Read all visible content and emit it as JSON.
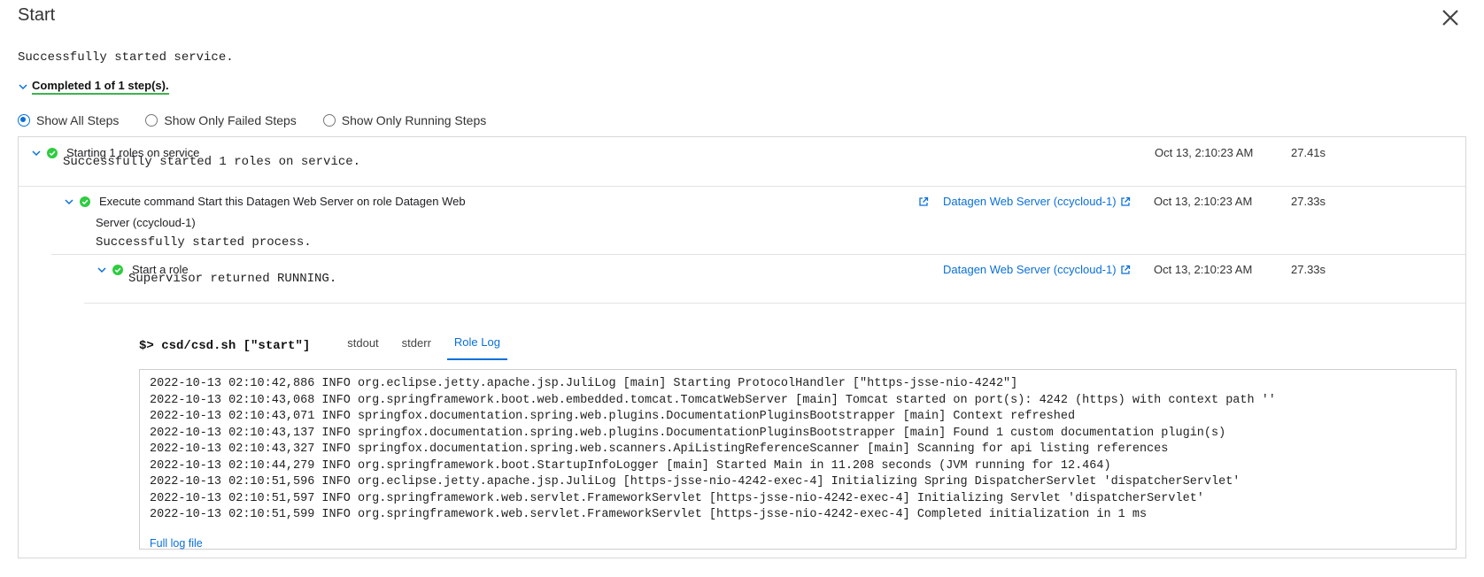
{
  "dialog": {
    "title": "Start",
    "close_icon": "close-icon"
  },
  "status_message": "Successfully started service.",
  "steps_summary": "Completed 1 of 1 step(s).",
  "filters": [
    {
      "label": "Show All Steps",
      "selected": true
    },
    {
      "label": "Show Only Failed Steps",
      "selected": false
    },
    {
      "label": "Show Only Running Steps",
      "selected": false
    }
  ],
  "steps": [
    {
      "label": "Starting 1 roles on service",
      "detail": "Successfully started 1 roles on service.",
      "time": "Oct 13, 2:10:23 AM",
      "duration": "27.41s",
      "status_icon": "check-circle-icon"
    },
    {
      "label": "Execute command Start this Datagen Web Server on role Datagen Web Server (ccycloud-1)",
      "label_line1": "Execute command Start this Datagen Web Server on role Datagen Web",
      "label_line2": "Server (ccycloud-1)",
      "detail": "Successfully started process.",
      "link": "Datagen Web Server (ccycloud-1)",
      "time": "Oct 13, 2:10:23 AM",
      "duration": "27.33s",
      "status_icon": "check-circle-icon"
    },
    {
      "label": "Start a role",
      "detail": "Supervisor returned RUNNING.",
      "link": "Datagen Web Server (ccycloud-1)",
      "time": "Oct 13, 2:10:23 AM",
      "duration": "27.33s",
      "status_icon": "check-circle-icon"
    }
  ],
  "command": {
    "prompt": "$>",
    "text": "csd/csd.sh [\"start\"]",
    "tabs": [
      "stdout",
      "stderr",
      "Role Log"
    ],
    "active_tab": "Role Log"
  },
  "log": {
    "lines": [
      "2022-10-13 02:10:42,886 INFO org.eclipse.jetty.apache.jsp.JuliLog [main] Starting ProtocolHandler [\"https-jsse-nio-4242\"]",
      "2022-10-13 02:10:43,068 INFO org.springframework.boot.web.embedded.tomcat.TomcatWebServer [main] Tomcat started on port(s): 4242 (https) with context path ''",
      "2022-10-13 02:10:43,071 INFO springfox.documentation.spring.web.plugins.DocumentationPluginsBootstrapper [main] Context refreshed",
      "2022-10-13 02:10:43,137 INFO springfox.documentation.spring.web.plugins.DocumentationPluginsBootstrapper [main] Found 1 custom documentation plugin(s)",
      "2022-10-13 02:10:43,327 INFO springfox.documentation.spring.web.scanners.ApiListingReferenceScanner [main] Scanning for api listing references",
      "2022-10-13 02:10:44,279 INFO org.springframework.boot.StartupInfoLogger [main] Started Main in 11.208 seconds (JVM running for 12.464)",
      "2022-10-13 02:10:51,596 INFO org.eclipse.jetty.apache.jsp.JuliLog [https-jsse-nio-4242-exec-4] Initializing Spring DispatcherServlet 'dispatcherServlet'",
      "2022-10-13 02:10:51,597 INFO org.springframework.web.servlet.FrameworkServlet [https-jsse-nio-4242-exec-4] Initializing Servlet 'dispatcherServlet'",
      "2022-10-13 02:10:51,599 INFO org.springframework.web.servlet.FrameworkServlet [https-jsse-nio-4242-exec-4] Completed initialization in 1 ms"
    ],
    "full_log_link": "Full log file"
  },
  "colors": {
    "accent": "#0a6fd8",
    "success": "#2ecc40",
    "summary_underline": "#3cb44b"
  }
}
